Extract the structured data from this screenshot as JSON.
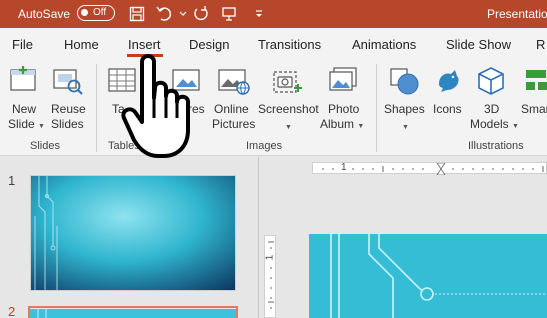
{
  "titlebar": {
    "autosave_label": "AutoSave",
    "autosave_state": "Off",
    "document_title": "Presentatio",
    "background_color": "#b7472a"
  },
  "tabs": [
    {
      "label": "File"
    },
    {
      "label": "Home"
    },
    {
      "label": "Insert",
      "active": true
    },
    {
      "label": "Design"
    },
    {
      "label": "Transitions"
    },
    {
      "label": "Animations"
    },
    {
      "label": "Slide Show"
    },
    {
      "label": "R"
    }
  ],
  "ribbon": {
    "new_slide": {
      "line1": "New",
      "line2": "Slide"
    },
    "reuse_slides": {
      "line1": "Reuse",
      "line2": "Slides"
    },
    "table": {
      "line1": "Ta"
    },
    "pictures": {
      "line1": "res"
    },
    "online_pictures": {
      "line1": "Online",
      "line2": "Pictures"
    },
    "screenshot": {
      "line1": "Screenshot"
    },
    "photo_album": {
      "line1": "Photo",
      "line2": "Album"
    },
    "shapes": {
      "line1": "Shapes"
    },
    "icons": {
      "line1": "Icons"
    },
    "models_3d": {
      "line1": "3D",
      "line2": "Models"
    },
    "smartart": {
      "line1": "Smar"
    },
    "groups": {
      "slides": "Slides",
      "tables": "Tables",
      "images": "Images",
      "illustrations": "Illustrations"
    }
  },
  "slides_panel": {
    "slide1_number": "1",
    "slide2_number": "2"
  },
  "ruler": {
    "h_mark": "1",
    "v_mark": "1"
  },
  "colors": {
    "accent": "#c43e1c",
    "slide_cyan": "#2fb5cf"
  },
  "overlay": {
    "cursor": "hand-pointer-icon"
  }
}
